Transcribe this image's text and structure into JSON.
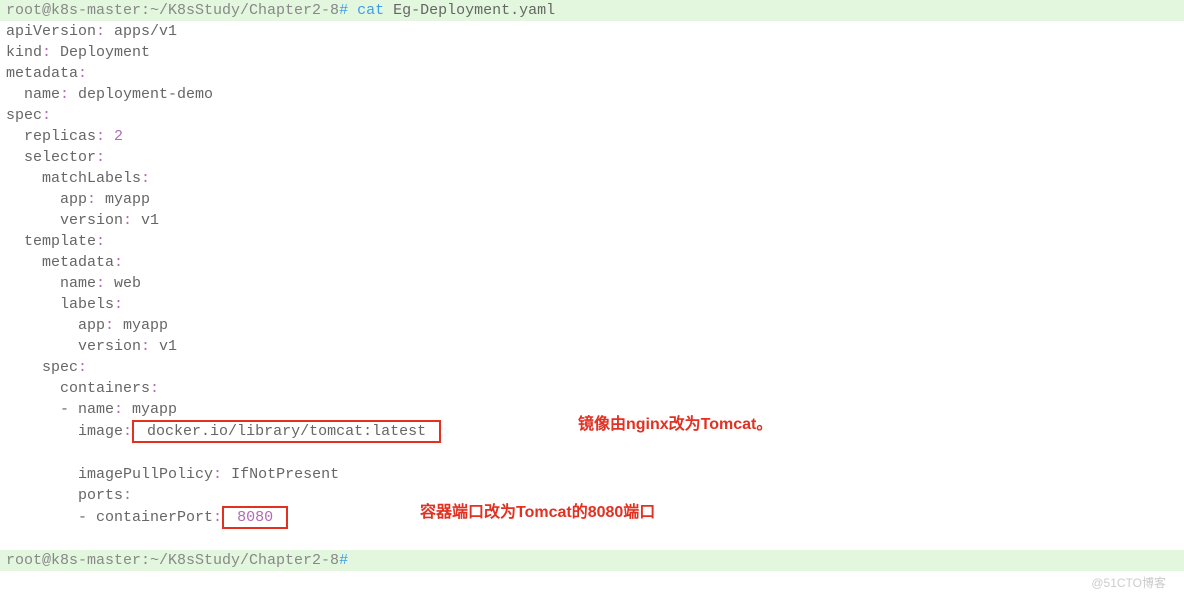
{
  "prompt1": {
    "user": "root@k8s-master",
    "path": ":~/K8sStudy/Chapter2-8",
    "hash": "#",
    "cmd": "cat",
    "arg": "Eg-Deployment.yaml"
  },
  "yaml": {
    "l1a": "apiVersion",
    "l1c": ":",
    "l1b": " apps/v1",
    "l2a": "kind",
    "l2c": ":",
    "l2b": " Deployment",
    "l3a": "metadata",
    "l3c": ":",
    "l4a": "  name",
    "l4c": ":",
    "l4b": " deployment-demo",
    "l5a": "spec",
    "l5c": ":",
    "l6a": "  replicas",
    "l6c": ":",
    "l6b": " 2",
    "l7a": "  selector",
    "l7c": ":",
    "l8a": "    matchLabels",
    "l8c": ":",
    "l9a": "      app",
    "l9c": ":",
    "l9b": " myapp",
    "l10a": "      version",
    "l10c": ":",
    "l10b": " v1",
    "l11a": "  template",
    "l11c": ":",
    "l12a": "    metadata",
    "l12c": ":",
    "l13a": "      name",
    "l13c": ":",
    "l13b": " web",
    "l14a": "      labels",
    "l14c": ":",
    "l15a": "        app",
    "l15c": ":",
    "l15b": " myapp",
    "l16a": "        version",
    "l16c": ":",
    "l16b": " v1",
    "l17a": "    spec",
    "l17c": ":",
    "l18a": "      containers",
    "l18c": ":",
    "l19a": "      - name",
    "l19c": ":",
    "l19b": " myapp",
    "l20a": "        image",
    "l20c": ":",
    "l20b": " docker.io/library/tomcat:latest ",
    "l21a": "        imagePullPolicy",
    "l21c": ":",
    "l21b": " IfNotPresent",
    "l22a": "        ports",
    "l22c": ":",
    "l23a": "        - containerPort",
    "l23c": ":",
    "l23b": " 8080 "
  },
  "annotations": {
    "image": "镜像由nginx改为Tomcat。",
    "port": "容器端口改为Tomcat的8080端口"
  },
  "prompt2": {
    "user": "root@k8s-master",
    "path": ":~/K8sStudy/Chapter2-8",
    "hash": "#"
  },
  "watermark": "@51CTO博客"
}
